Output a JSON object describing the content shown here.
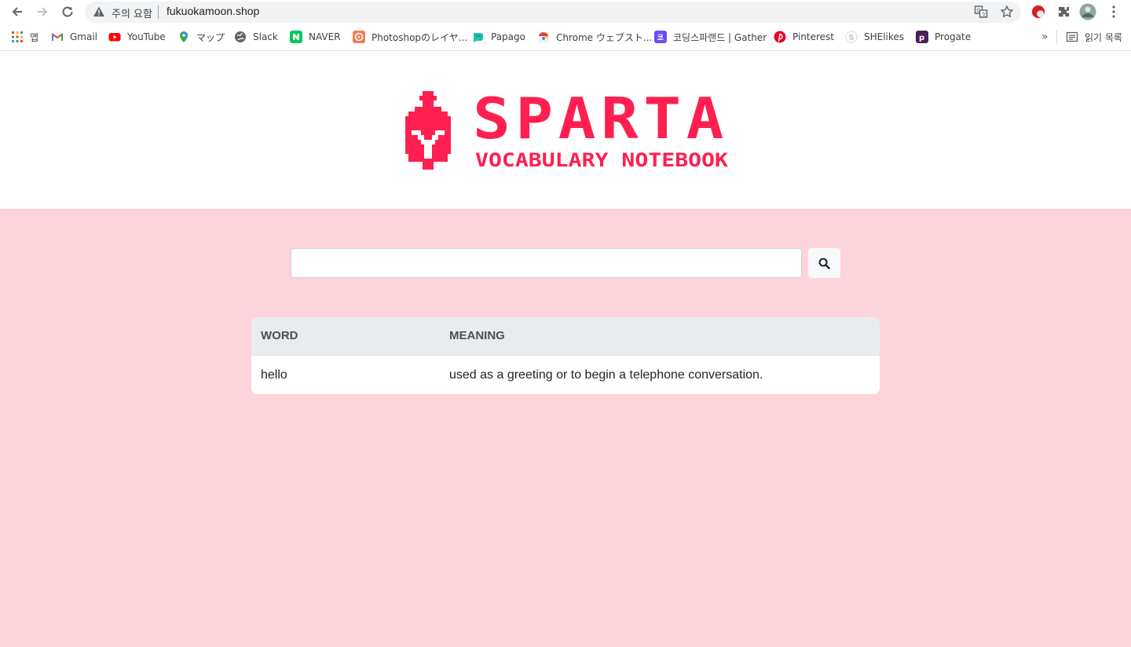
{
  "browser": {
    "security_label": "주의 요함",
    "url": "fukuokamoon.shop",
    "bookmarks": [
      {
        "label": "앱",
        "icon": "apps-grid-icon"
      },
      {
        "label": "Gmail",
        "icon": "gmail-icon"
      },
      {
        "label": "YouTube",
        "icon": "youtube-icon"
      },
      {
        "label": "マップ",
        "icon": "maps-icon"
      },
      {
        "label": "Slack",
        "icon": "globe-icon"
      },
      {
        "label": "NAVER",
        "icon": "naver-icon"
      },
      {
        "label": "Photoshopのレイヤ...",
        "icon": "photoshop-icon"
      },
      {
        "label": "Papago",
        "icon": "papago-icon"
      },
      {
        "label": "Chrome ウェブスト...",
        "icon": "chrome-webstore-icon"
      },
      {
        "label": "코딩스파랜드 | Gather",
        "icon": "gather-icon"
      },
      {
        "label": "Pinterest",
        "icon": "pinterest-icon"
      },
      {
        "label": "SHElikes",
        "icon": "shelikes-icon"
      },
      {
        "label": "Progate",
        "icon": "progate-icon"
      }
    ],
    "more_label": "»",
    "reading_list_label": "읽기 목록"
  },
  "page": {
    "logo_title": "SPARTA",
    "logo_subtitle": "VOCABULARY NOTEBOOK",
    "brand_color": "#ff1f50",
    "search": {
      "value": "",
      "placeholder": ""
    },
    "table": {
      "headers": [
        "WORD",
        "MEANING"
      ],
      "rows": [
        {
          "word": "hello",
          "meaning": "used as a greeting or to begin a telephone conversation."
        }
      ]
    }
  }
}
